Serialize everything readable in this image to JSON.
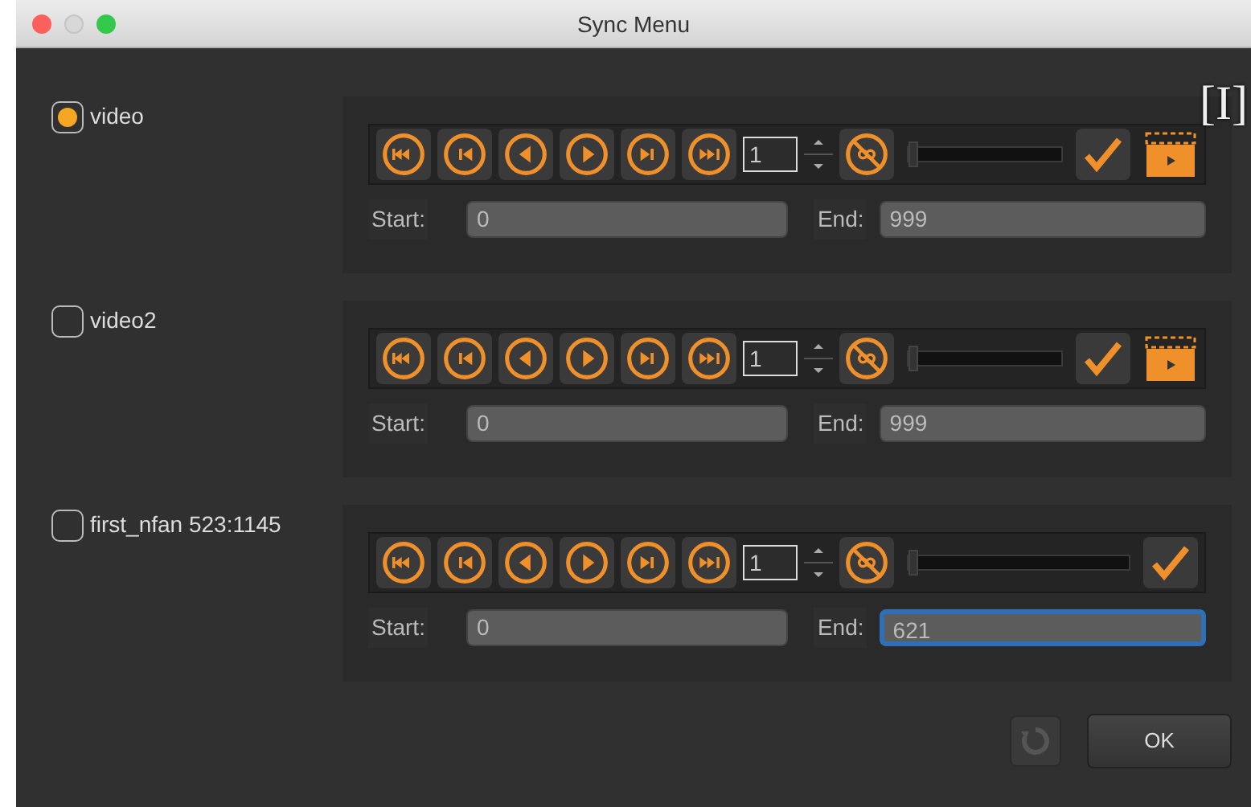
{
  "window": {
    "title": "Sync Menu"
  },
  "overlay_mark": "[I]",
  "sections": [
    {
      "label": "video",
      "selected": true,
      "frame": "1",
      "level": 0,
      "start_label": "Start:",
      "start": "0",
      "end_label": "End:",
      "end": "999",
      "end_focused": false,
      "clapper": true
    },
    {
      "label": "video2",
      "selected": false,
      "frame": "1",
      "level": 0,
      "start_label": "Start:",
      "start": "0",
      "end_label": "End:",
      "end": "999",
      "end_focused": false,
      "clapper": true
    },
    {
      "label": "first_nfan 523:1145",
      "selected": false,
      "frame": "1",
      "level": 0,
      "start_label": "Start:",
      "start": "0",
      "end_label": "End:",
      "end": "621",
      "end_focused": true,
      "clapper": false
    }
  ],
  "ok_button": "OK"
}
